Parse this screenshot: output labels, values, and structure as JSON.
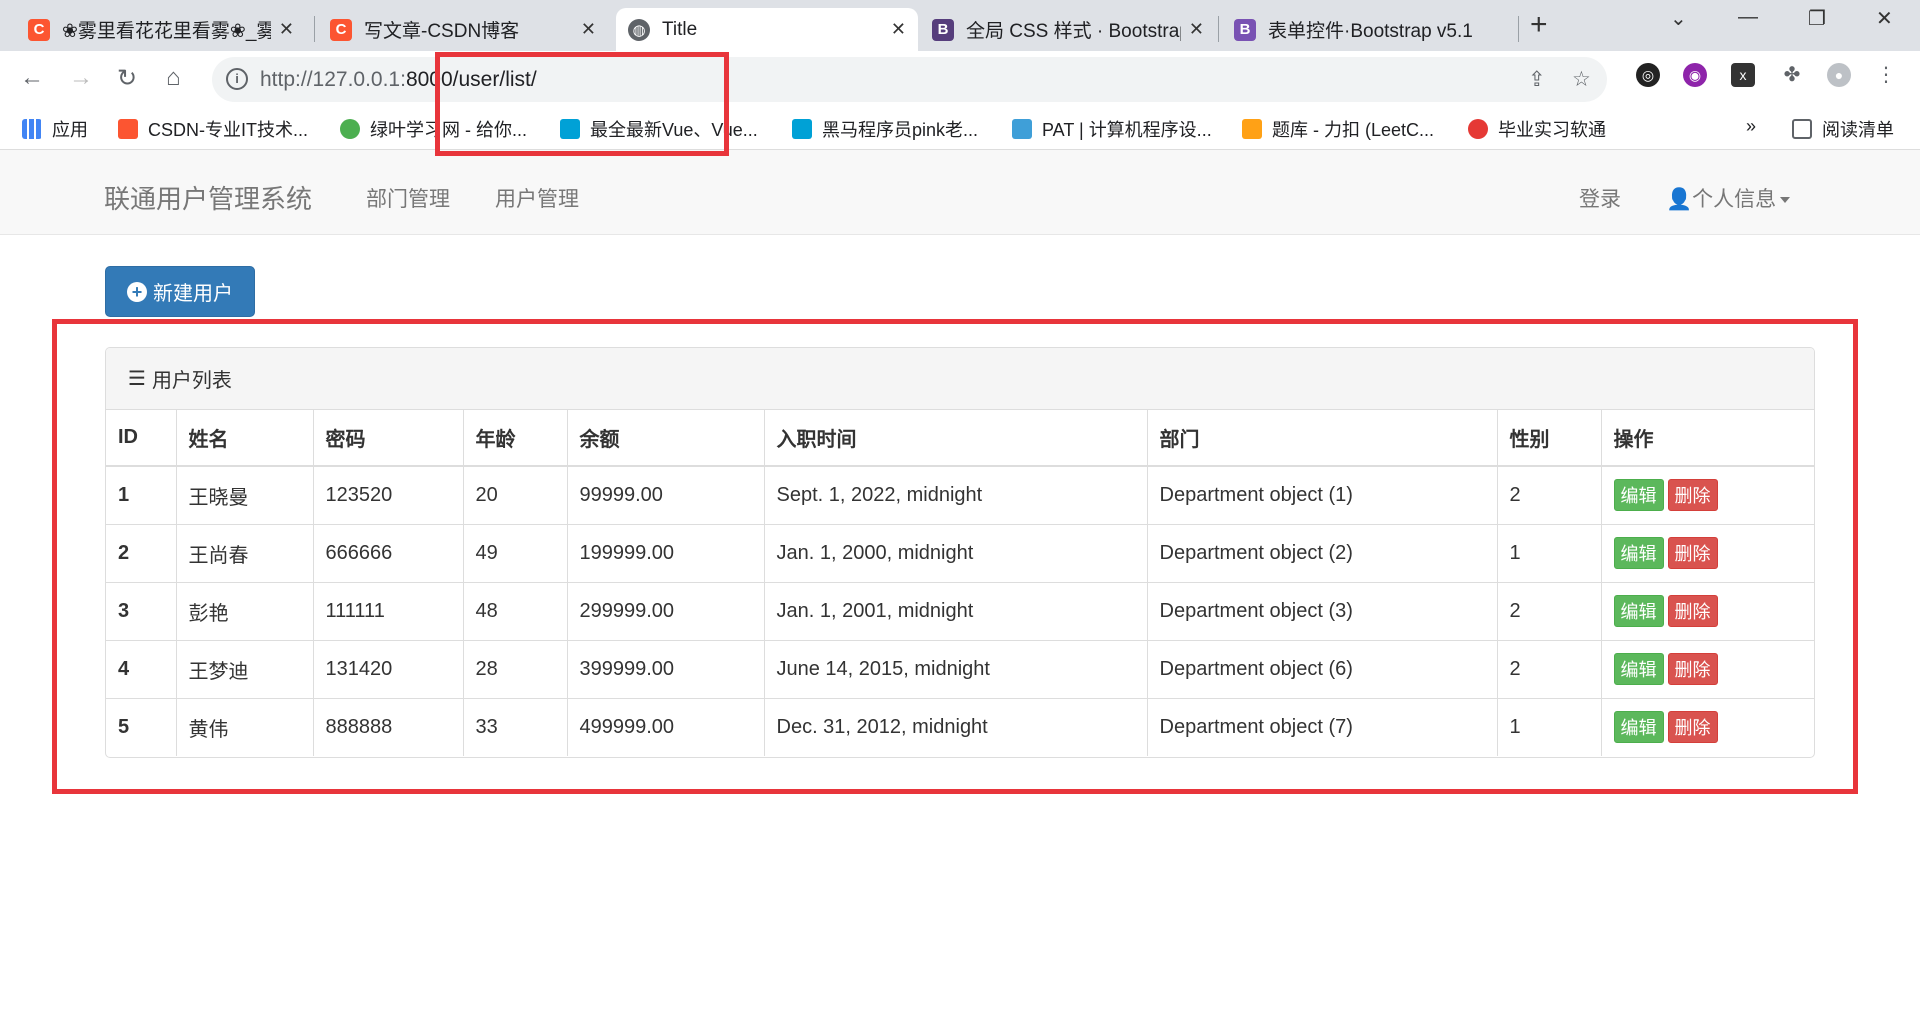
{
  "browser": {
    "tabs": [
      {
        "title": "❀雾里看花花里看雾❀_雾",
        "favicon": "csdn-icon",
        "color": "#fc5531"
      },
      {
        "title": "写文章-CSDN博客",
        "favicon": "csdn-icon",
        "color": "#fc5531"
      },
      {
        "title": "Title",
        "favicon": "globe-icon",
        "color": "#5f6368"
      },
      {
        "title": "全局 CSS 样式 · Bootstrap",
        "favicon": "bootstrap-icon",
        "color": "#563d7c"
      },
      {
        "title": "表单控件·Bootstrap v5.1",
        "favicon": "bootstrap-icon",
        "color": "#7952b3"
      }
    ],
    "url_host": "http://127.0.0.1:",
    "url_path": "8000/user/list/",
    "bookmarks": [
      {
        "label": "应用",
        "icon": "apps-grid-icon"
      },
      {
        "label": "CSDN-专业IT技术...",
        "icon": "csdn-icon"
      },
      {
        "label": "绿叶学习网 - 给你...",
        "icon": "leaf-icon"
      },
      {
        "label": "最全最新Vue、Vue...",
        "icon": "bilibili-icon"
      },
      {
        "label": "黑马程序员pink老...",
        "icon": "bilibili-icon"
      },
      {
        "label": "PAT | 计算机程序设...",
        "icon": "pat-icon"
      },
      {
        "label": "题库 - 力扣 (LeetC...",
        "icon": "leetcode-icon"
      },
      {
        "label": "毕业实习软通",
        "icon": "bookmark-icon"
      }
    ],
    "more_label": "»",
    "reading_list": "阅读清单"
  },
  "navbar": {
    "brand": "联通用户管理系统",
    "links": [
      "部门管理",
      "用户管理"
    ],
    "login": "登录",
    "profile": "个人信息"
  },
  "new_user_button": "新建用户",
  "panel_title": "用户列表",
  "table": {
    "headers": [
      "ID",
      "姓名",
      "密码",
      "年龄",
      "余额",
      "入职时间",
      "部门",
      "性别",
      "操作"
    ],
    "rows": [
      [
        "1",
        "王晓曼",
        "123520",
        "20",
        "99999.00",
        "Sept. 1, 2022, midnight",
        "Department object (1)",
        "2"
      ],
      [
        "2",
        "王尚春",
        "666666",
        "49",
        "199999.00",
        "Jan. 1, 2000, midnight",
        "Department object (2)",
        "1"
      ],
      [
        "3",
        "彭艳",
        "111111",
        "48",
        "299999.00",
        "Jan. 1, 2001, midnight",
        "Department object (3)",
        "2"
      ],
      [
        "4",
        "王梦迪",
        "131420",
        "28",
        "399999.00",
        "June 14, 2015, midnight",
        "Department object (6)",
        "2"
      ],
      [
        "5",
        "黄伟",
        "888888",
        "33",
        "499999.00",
        "Dec. 31, 2012, midnight",
        "Department object (7)",
        "1"
      ]
    ],
    "edit_label": "编辑",
    "delete_label": "删除"
  },
  "colors": {
    "primary": "#337ab7",
    "success": "#5cb85c",
    "danger": "#d9534f",
    "highlight_box": "#e8353b"
  }
}
